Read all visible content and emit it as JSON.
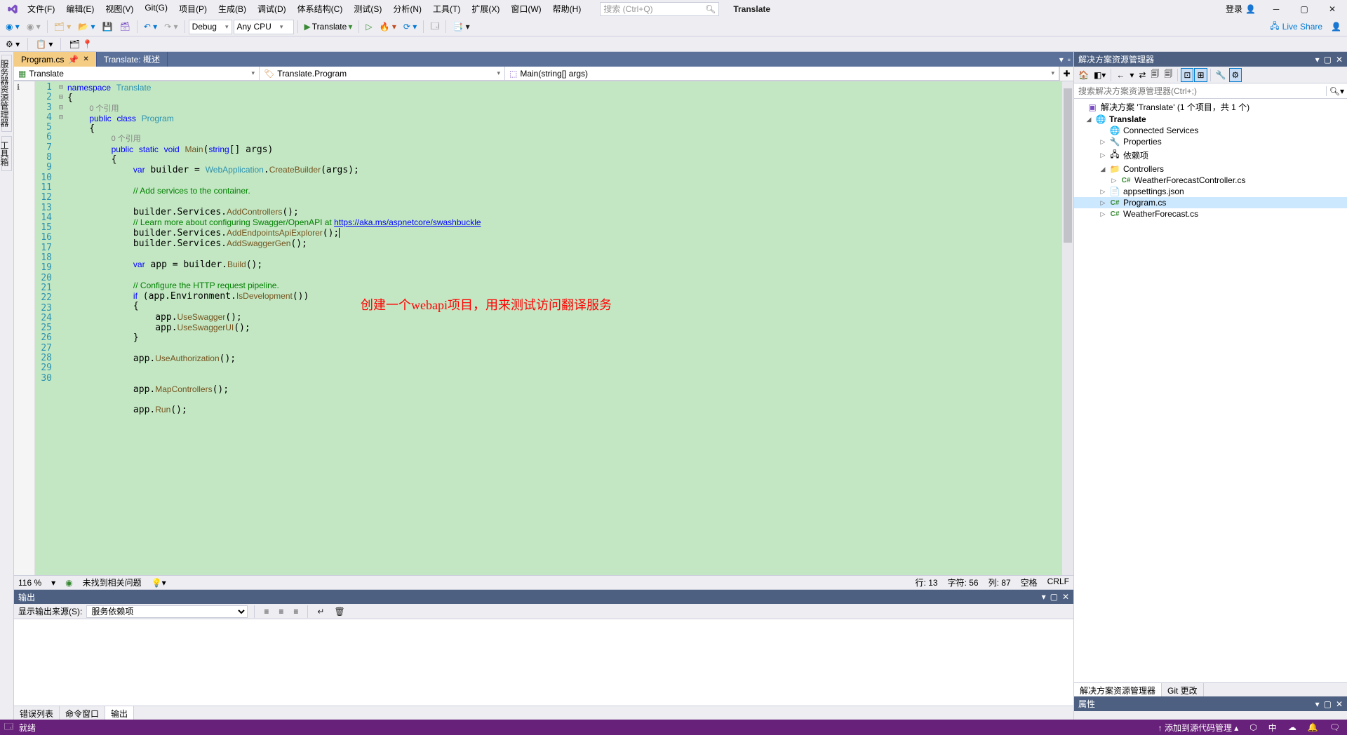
{
  "menu": [
    "文件(F)",
    "编辑(E)",
    "视图(V)",
    "Git(G)",
    "项目(P)",
    "生成(B)",
    "调试(D)",
    "体系结构(C)",
    "测试(S)",
    "分析(N)",
    "工具(T)",
    "扩展(X)",
    "窗口(W)",
    "帮助(H)"
  ],
  "search_placeholder": "搜索 (Ctrl+Q)",
  "app_title": "Translate",
  "login": "登录",
  "toolbar": {
    "config": "Debug",
    "platform": "Any CPU",
    "start": "Translate",
    "liveshare": "Live Share"
  },
  "left_tabs": [
    "服务器资源管理器",
    "工具箱"
  ],
  "doc_tabs": [
    {
      "label": "Program.cs",
      "active": true
    },
    {
      "label": "Translate: 概述",
      "active": false
    }
  ],
  "nav": {
    "scope": "Translate",
    "class": "Translate.Program",
    "member": "Main(string[] args)"
  },
  "code_lines": [
    1,
    2,
    "",
    3,
    4,
    "",
    5,
    6,
    7,
    8,
    9,
    10,
    11,
    12,
    13,
    14,
    15,
    16,
    17,
    18,
    19,
    20,
    21,
    22,
    23,
    24,
    25,
    26,
    27,
    28,
    29,
    30
  ],
  "references_text": "0 个引用",
  "url": "https://aka.ms/aspnetcore/swashbuckle",
  "annotation": "创建一个webapi项目，用来测试访问翻译服务",
  "editor_status": {
    "zoom": "116 %",
    "issues": "未找到相关问题",
    "line": "行: 13",
    "char": "字符: 56",
    "col": "列: 87",
    "ins": "空格",
    "eol": "CRLF"
  },
  "output": {
    "title": "输出",
    "source_label": "显示输出来源(S):",
    "source_value": "服务依赖项"
  },
  "bottom_tabs": [
    "错误列表",
    "命令窗口",
    "输出"
  ],
  "solution": {
    "title": "解决方案资源管理器",
    "search_placeholder": "搜索解决方案资源管理器(Ctrl+;)",
    "root": "解决方案 'Translate' (1 个项目，共 1 个)",
    "project": "Translate",
    "items": [
      {
        "icon": "globe",
        "label": "Connected Services",
        "indent": 3,
        "arrow": ""
      },
      {
        "icon": "wrench",
        "label": "Properties",
        "indent": 3,
        "arrow": "▷"
      },
      {
        "icon": "dep",
        "label": "依赖项",
        "indent": 3,
        "arrow": "▷"
      },
      {
        "icon": "folder",
        "label": "Controllers",
        "indent": 3,
        "arrow": "◢"
      },
      {
        "icon": "cs",
        "label": "WeatherForecastController.cs",
        "indent": 4,
        "arrow": "▷"
      },
      {
        "icon": "json",
        "label": "appsettings.json",
        "indent": 3,
        "arrow": "▷"
      },
      {
        "icon": "cs",
        "label": "Program.cs",
        "indent": 3,
        "arrow": "▷",
        "sel": true
      },
      {
        "icon": "cs",
        "label": "WeatherForecast.cs",
        "indent": 3,
        "arrow": "▷"
      }
    ],
    "bottom_tabs": [
      "解决方案资源管理器",
      "Git 更改"
    ]
  },
  "properties_title": "属性",
  "statusbar": {
    "ready": "就绪",
    "scm": "添加到源代码管理",
    "repo_icon": "▲"
  }
}
